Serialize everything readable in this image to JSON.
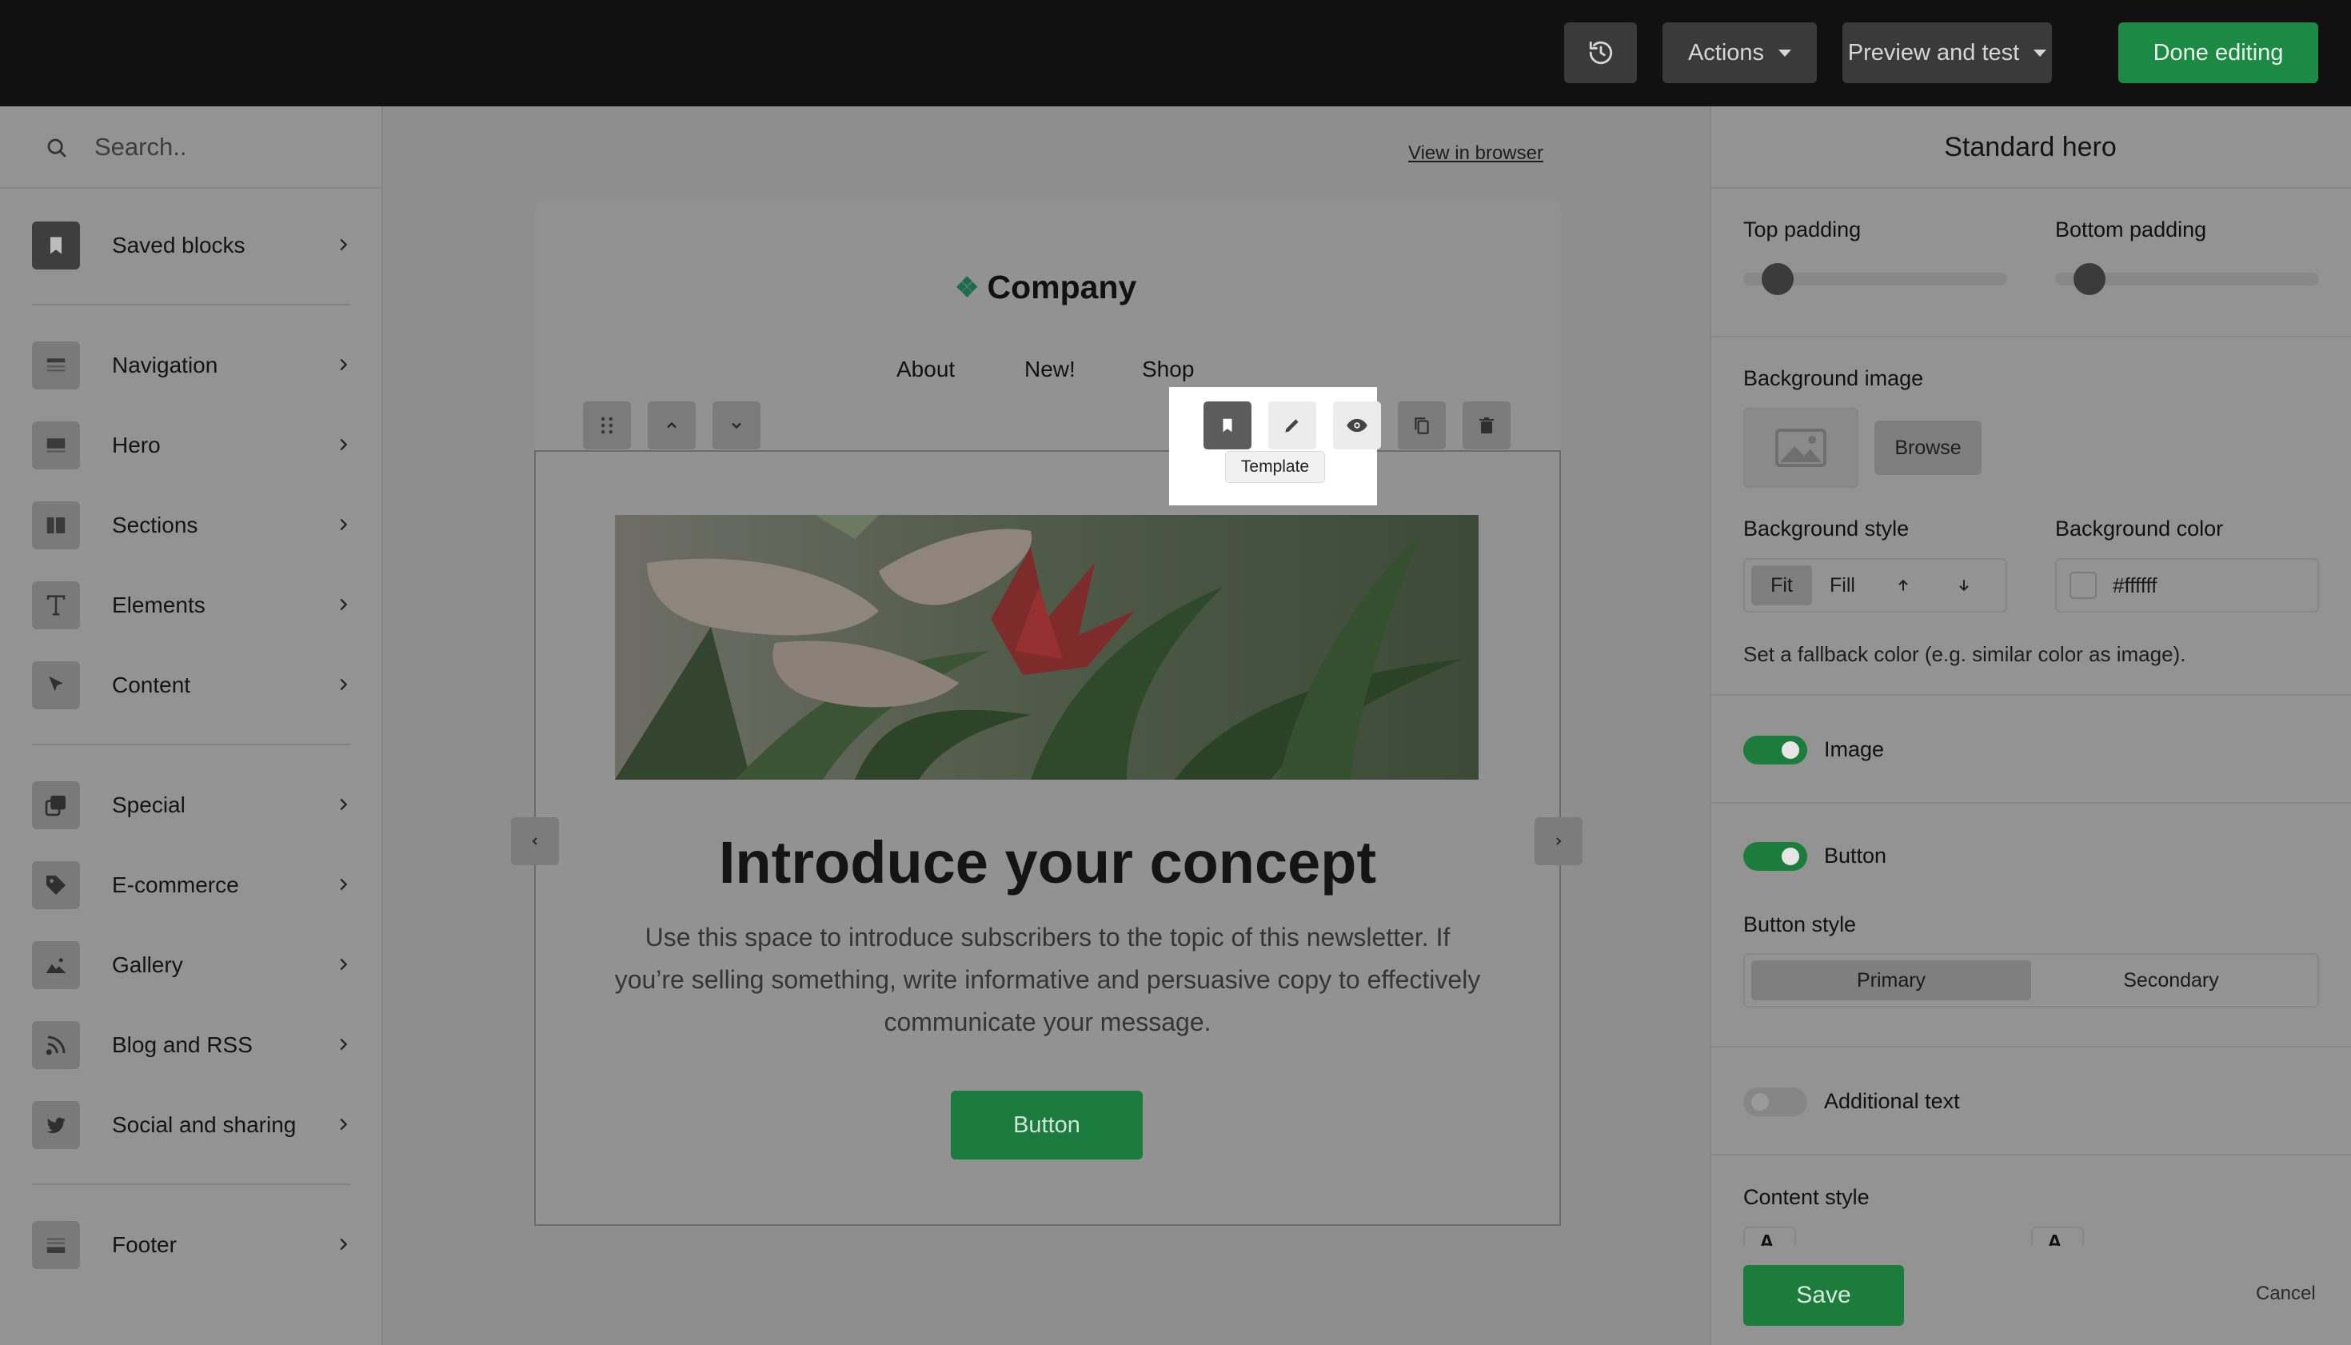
{
  "topbar": {
    "actions_label": "Actions",
    "preview_label": "Preview and test",
    "done_label": "Done editing"
  },
  "sidebar": {
    "search_placeholder": "Search..",
    "items": [
      {
        "label": "Saved blocks",
        "icon": "bookmark-icon"
      },
      {
        "label": "Navigation",
        "icon": "navigation-icon"
      },
      {
        "label": "Hero",
        "icon": "hero-icon"
      },
      {
        "label": "Sections",
        "icon": "sections-icon"
      },
      {
        "label": "Elements",
        "icon": "text-icon"
      },
      {
        "label": "Content",
        "icon": "cursor-icon"
      },
      {
        "label": "Special",
        "icon": "special-icon"
      },
      {
        "label": "E-commerce",
        "icon": "tag-icon"
      },
      {
        "label": "Gallery",
        "icon": "image-icon"
      },
      {
        "label": "Blog and RSS",
        "icon": "rss-icon"
      },
      {
        "label": "Social and sharing",
        "icon": "twitter-icon"
      },
      {
        "label": "Footer",
        "icon": "footer-icon"
      }
    ]
  },
  "canvas": {
    "view_in_browser": "View in browser",
    "company": "Company",
    "nav": [
      "About",
      "New!",
      "Shop"
    ],
    "tooltip": "Template",
    "hero_title": "Introduce your concept",
    "hero_body": "Use this space to introduce subscribers to the topic of this newsletter. If you’re selling something, write informative and persuasive copy to effectively communicate your message.",
    "hero_button": "Button"
  },
  "panel": {
    "title": "Standard hero",
    "top_padding": "Top padding",
    "bottom_padding": "Bottom padding",
    "background_image": "Background image",
    "browse": "Browse",
    "background_style": "Background style",
    "style_options": [
      "Fit",
      "Fill"
    ],
    "background_color": "Background color",
    "color_value": "#ffffff",
    "fallback_hint": "Set a fallback color (e.g. similar color as image).",
    "image_toggle": "Image",
    "button_toggle": "Button",
    "button_style": "Button style",
    "button_style_options": [
      "Primary",
      "Secondary"
    ],
    "additional_text": "Additional text",
    "content_style": "Content style",
    "content_style_glyph": "A",
    "save": "Save",
    "cancel": "Cancel"
  },
  "colors": {
    "accent_green": "#1c8a44",
    "topbar_bg": "#111111"
  }
}
